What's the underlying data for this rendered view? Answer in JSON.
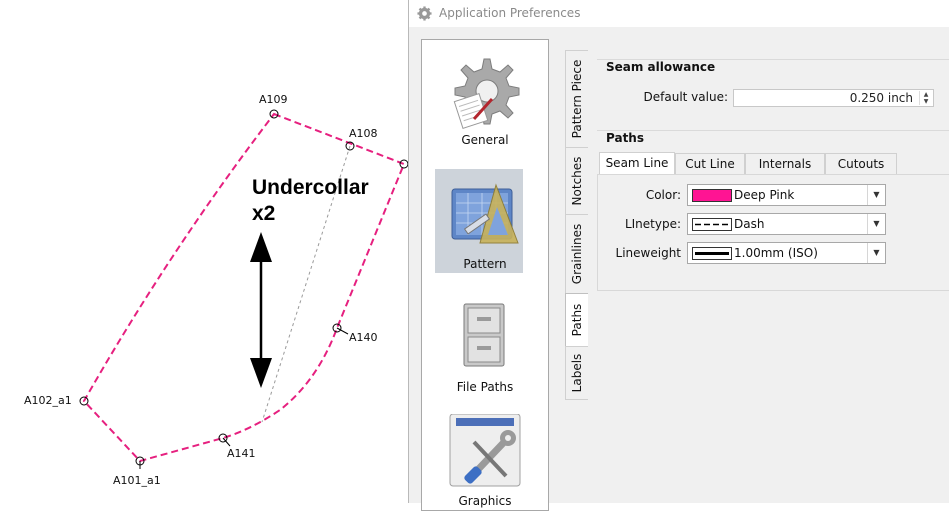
{
  "piece": {
    "title_line1": "Undercollar",
    "title_line2": "x2",
    "color": "#e6207f",
    "points": {
      "A109": "A109",
      "A108": "A108",
      "A140": "A140",
      "A141": "A141",
      "A101_a1": "A101_a1",
      "A102_a1": "A102_a1"
    }
  },
  "dialog": {
    "title": "Application Preferences",
    "categories": [
      {
        "label": "General",
        "icon": "gear-icon"
      },
      {
        "label": "Pattern",
        "icon": "pattern-tools-icon",
        "selected": true
      },
      {
        "label": "File Paths",
        "icon": "file-cabinet-icon"
      },
      {
        "label": "Graphics",
        "icon": "wrench-icon"
      }
    ],
    "vertical_tabs": [
      "Pattern Piece",
      "Notches",
      "Grainlines",
      "Paths",
      "Labels"
    ],
    "active_vertical_tab": "Paths",
    "seam_allowance": {
      "title": "Seam allowance",
      "default_label": "Default value:",
      "default_value": "0.250 inch"
    },
    "paths": {
      "title": "Paths",
      "tabs": [
        "Seam Line",
        "Cut Line",
        "Internals",
        "Cutouts"
      ],
      "active_tab": "Seam Line",
      "color_label": "Color:",
      "color_value": "Deep Pink",
      "color_swatch": "#ff1493",
      "linetype_label": "LInetype:",
      "linetype_value": "Dash",
      "lineweight_label": "Lineweight",
      "lineweight_value": "1.00mm (ISO)"
    }
  }
}
